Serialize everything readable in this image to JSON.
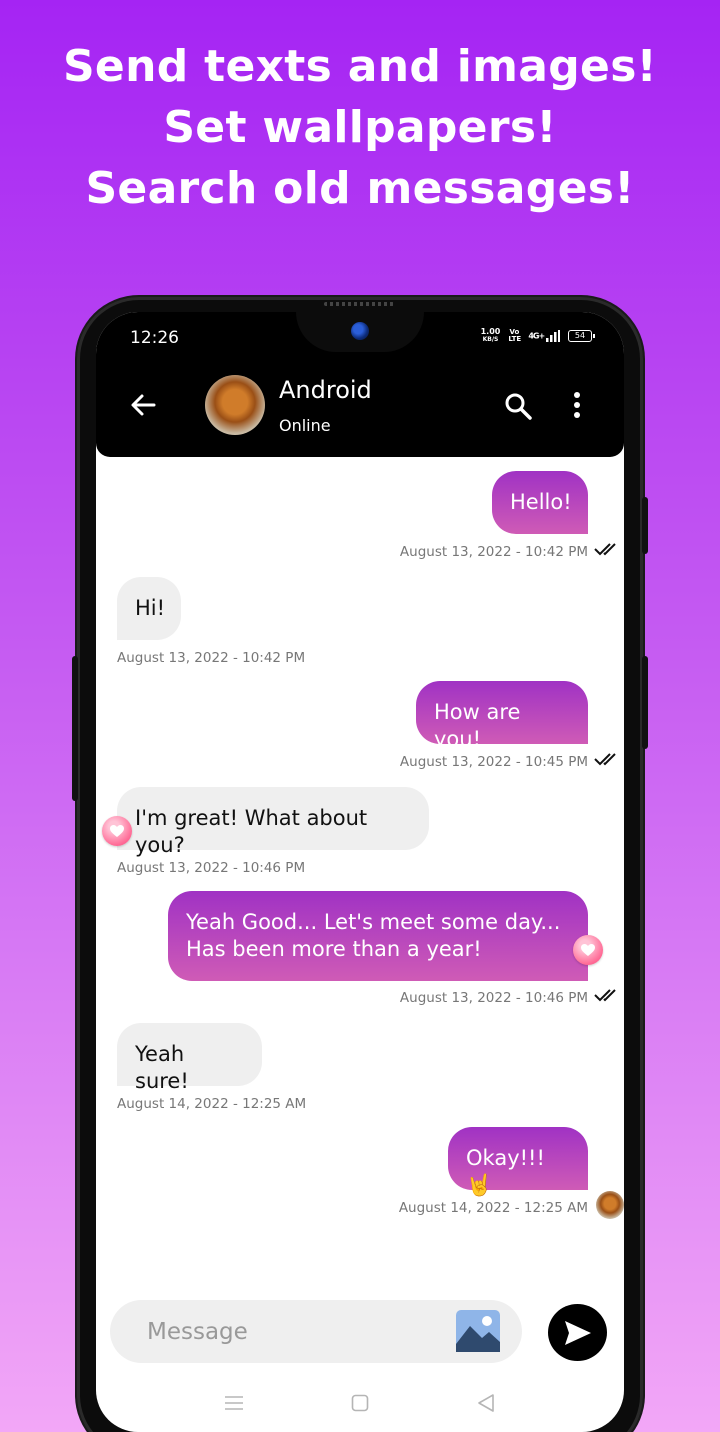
{
  "promo": {
    "line1": "Send texts and images!",
    "line2": "Set wallpapers!",
    "line3": "Search old messages!"
  },
  "status_bar": {
    "time": "12:26",
    "speed_value": "1.00",
    "speed_unit": "KB/S",
    "volte": "Vo LTE",
    "network": "4G+",
    "battery": "54"
  },
  "header": {
    "contact_name": "Android",
    "contact_status": "Online",
    "icons": [
      "back-arrow-icon",
      "search-icon",
      "more-vert-icon"
    ]
  },
  "messages": [
    {
      "direction": "sent",
      "text": "Hello!",
      "timestamp": "August 13, 2022 - 10:42 PM",
      "status": "read"
    },
    {
      "direction": "received",
      "text": "Hi!",
      "timestamp": "August 13, 2022 - 10:42 PM"
    },
    {
      "direction": "sent",
      "text": "How are you!",
      "timestamp": "August 13, 2022 - 10:45 PM",
      "status": "read"
    },
    {
      "direction": "received",
      "text": "I'm great! What about you?",
      "timestamp": "August 13, 2022 - 10:46 PM",
      "reaction": "heart"
    },
    {
      "direction": "sent",
      "text_line1": "Yeah Good... Let's meet some day...",
      "text_line2": "Has been more than a year!",
      "timestamp": "August 13, 2022 - 10:46 PM",
      "status": "read",
      "reaction": "heart"
    },
    {
      "direction": "received",
      "text": "Yeah sure!",
      "timestamp": "August 14, 2022 - 12:25 AM"
    },
    {
      "direction": "sent",
      "text": "Okay!!! 🤘",
      "timestamp": "August 14, 2022 - 12:25 AM",
      "status": "seen-avatar"
    }
  ],
  "composer": {
    "placeholder": "Message"
  },
  "colors": {
    "background_top": "#a524f3",
    "background_bottom": "#f2a7f7",
    "sent_bubble_top": "#a032c4",
    "sent_bubble_bottom": "#cf5bb6",
    "received_bubble": "#efefef"
  }
}
